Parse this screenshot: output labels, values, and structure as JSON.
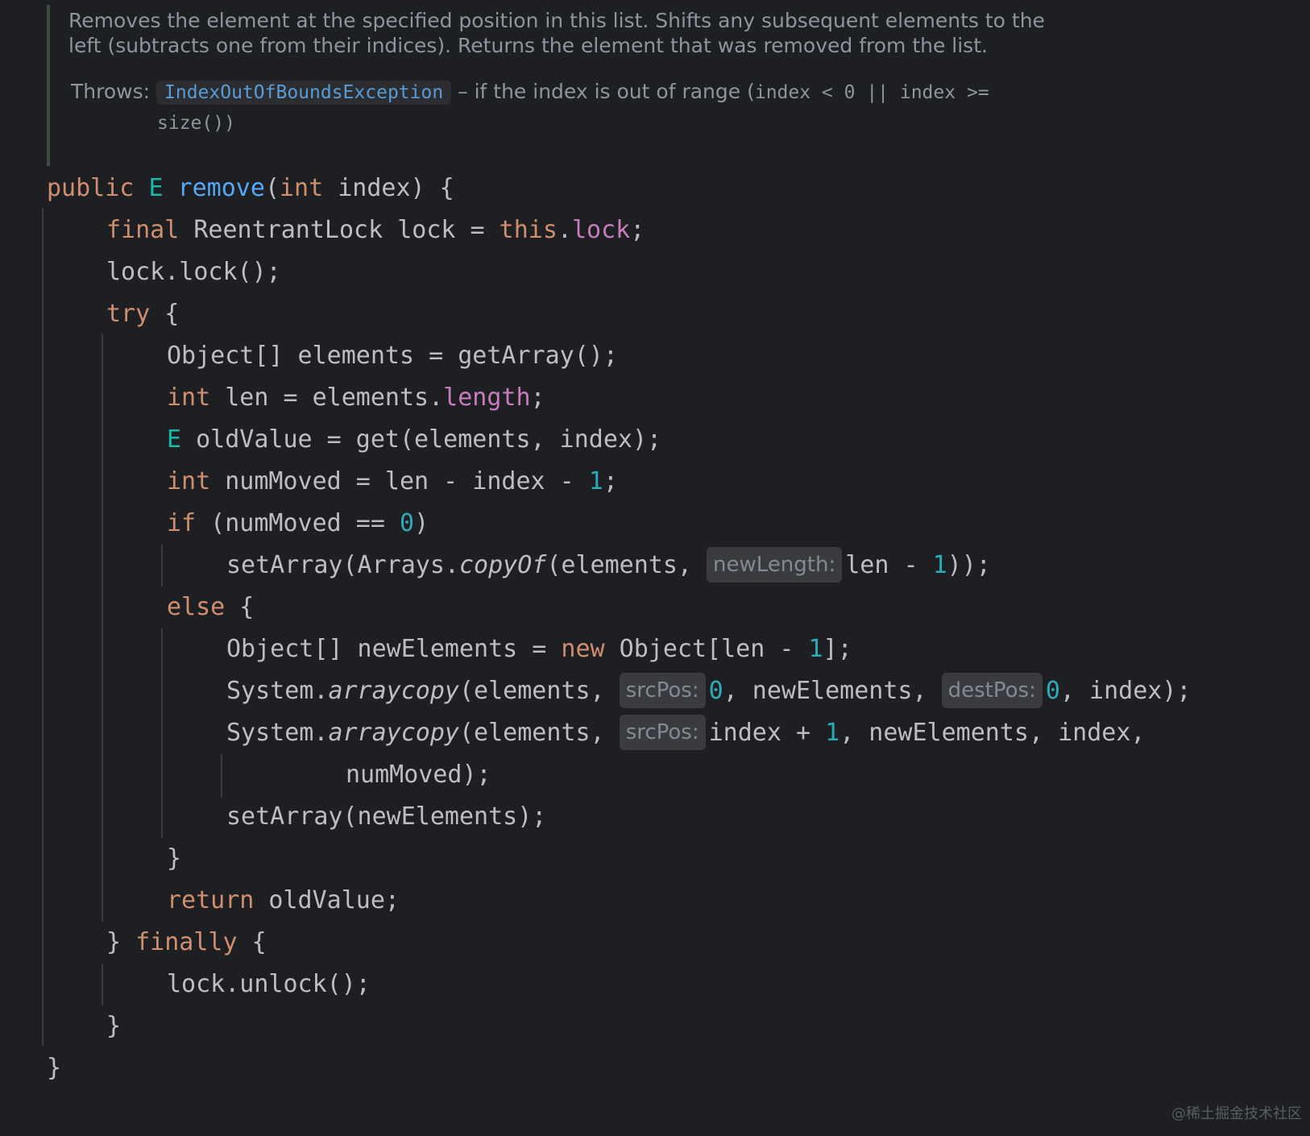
{
  "javadoc": {
    "description_line1": "Removes the element at the specified position in this list. Shifts any subsequent elements to the",
    "description_line2": "left (subtracts one from their indices). Returns the element that was removed from the list.",
    "throws_label": "Throws:",
    "exception": "IndexOutOfBoundsException",
    "throws_text": "– if the index is out of range (",
    "throws_code": "index < 0 || index >=",
    "throws_code2": "size())"
  },
  "code": {
    "sig_public": "public",
    "sig_E": "E",
    "sig_name": "remove",
    "sig_int": "int",
    "sig_rest": " index) {",
    "l2_final": "final",
    "l2_mid": " ReentrantLock lock = ",
    "l2_this": "this",
    "l2_dot": ".",
    "l2_lock": "lock",
    "l2_end": ";",
    "l3": "lock.lock();",
    "l4_try": "try",
    "l4_brace": " {",
    "l5": "Object[] elements = getArray();",
    "l6_int": "int",
    "l6_mid": " len = elements.",
    "l6_length": "length",
    "l6_end": ";",
    "l7_E": "E",
    "l7_rest": " oldValue = get(elements, index);",
    "l8_int": "int",
    "l8_mid": " numMoved = len - index - ",
    "l8_num": "1",
    "l8_end": ";",
    "l9_if": "if",
    "l9_mid": " (numMoved == ",
    "l9_num": "0",
    "l9_end": ")",
    "l10_pre": "setArray(Arrays.",
    "l10_copyOf": "copyOf",
    "l10_mid": "(elements, ",
    "l10_hint": "newLength:",
    "l10_post": "len - ",
    "l10_num": "1",
    "l10_end": "));",
    "l11_else": "else",
    "l11_brace": " {",
    "l12_pre": "Object[] newElements = ",
    "l12_new": "new",
    "l12_mid": " Object[len - ",
    "l12_num": "1",
    "l12_end": "];",
    "l13_pre": "System.",
    "l13_fn": "arraycopy",
    "l13_mid": "(elements, ",
    "l13_hint1": "srcPos:",
    "l13_num1": "0",
    "l13_mid2": ", newElements, ",
    "l13_hint2": "destPos:",
    "l13_num2": "0",
    "l13_end": ", index);",
    "l14_pre": "System.",
    "l14_fn": "arraycopy",
    "l14_mid": "(elements, ",
    "l14_hint": "srcPos:",
    "l14_idx": "index + ",
    "l14_num": "1",
    "l14_end": ", newElements, index,",
    "l15": "numMoved);",
    "l16": "setArray(newElements);",
    "l17": "}",
    "l18_return": "return",
    "l18_rest": " oldValue;",
    "l19_brace": "} ",
    "l19_finally": "finally",
    "l19_end": " {",
    "l20": "lock.unlock();",
    "l21": "}",
    "l22": "}"
  },
  "watermark": "@稀土掘金技术社区",
  "colors": {
    "background": "#1e1f22",
    "keyword": "#cf8e6d",
    "type_param": "#16baac",
    "function": "#56a8f5",
    "field": "#c77dbb",
    "number": "#2aacb8",
    "text": "#bcbec4",
    "doc": "#8d969e",
    "hint_bg": "#393b40"
  }
}
